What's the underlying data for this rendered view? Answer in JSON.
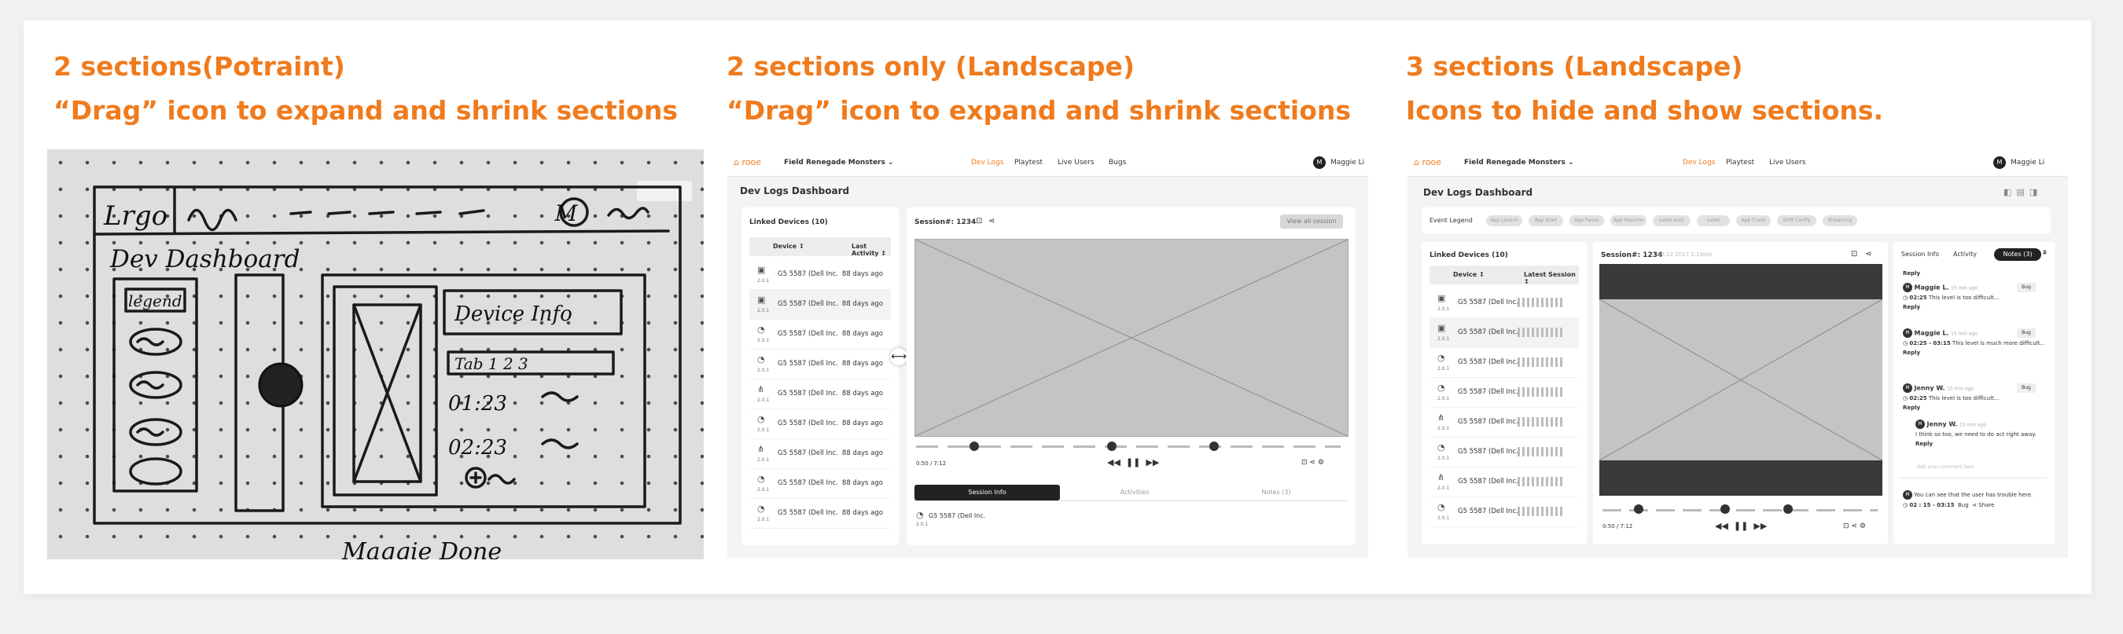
{
  "captions": [
    {
      "line1": "2 sections(Potraint)",
      "line2": "“Drag” icon to expand and shrink sections"
    },
    {
      "line1": "2 sections only (Landscape)",
      "line2": "“Drag” icon to expand and shrink sections"
    },
    {
      "line1": "3 sections (Landscape)",
      "line2": "Icons to hide and show sections."
    }
  ],
  "sketch": {
    "logo": "Lrgo",
    "title": "Dev Dashboard",
    "legend": "legend",
    "device_info": "Device Info",
    "tabs": "Tab 1 2 3",
    "times": [
      "01:23",
      "02:23"
    ],
    "avatar": "M",
    "footer": "Maggie Done"
  },
  "landscape2": {
    "brand": "rooe",
    "project": "Field Renegade Monsters",
    "nav": [
      "Dev Logs",
      "Playtest",
      "Live Users",
      "Bugs"
    ],
    "user": "Maggie Li",
    "avatar": "M",
    "page_title": "Dev Logs Dashboard",
    "devices_title": "Linked Devices (10)",
    "col_device": "Device",
    "col_activity": "Last Activity",
    "device_name": "G5 5587 (Dell Inc.",
    "version": "2.0.1",
    "rows": [
      "88 days ago",
      "88 days ago",
      "88 days ago",
      "88 days ago",
      "88 days ago",
      "88 days ago",
      "88 days ago",
      "88 days ago",
      "88 days ago"
    ],
    "row_icons": [
      "▣",
      "▣",
      "◔",
      "◔",
      "⋔",
      "◔",
      "⋔",
      "◔",
      "◔"
    ],
    "session_label": "Session#: 1234",
    "view_all": "View all session",
    "time": "0:50 / 7:12",
    "tabs": [
      "Session Info",
      "Activities",
      "Notes (3)"
    ],
    "info_device": "G5 5587 (Dell Inc.",
    "drag_icon": "⟷"
  },
  "landscape3": {
    "brand": "rooe",
    "project": "Field Renegade Monsters",
    "nav": [
      "Dev Logs",
      "Playtest",
      "Live Users"
    ],
    "user": "Maggie Li",
    "avatar": "M",
    "page_title": "Dev Logs Dashboard",
    "legend_label": "Event Legend",
    "chips": [
      "App Launch",
      "App Start",
      "App Pause",
      "App Resume",
      "Level start",
      "Level",
      "App Crash",
      "Shift Config",
      "Streaming"
    ],
    "devices_title": "Linked Devices (10)",
    "col_device": "Device",
    "col_session": "Latest Session",
    "device_name": "G5 5587 (Dell Inc.",
    "version": "2.0.1",
    "row_icons": [
      "▣",
      "▣",
      "◔",
      "◔",
      "⋔",
      "◔",
      "⋔",
      "◔"
    ],
    "session_label": "Session#: 1234",
    "session_date": "08.12.2017 2:10pm",
    "time": "0:50 / 7:12",
    "side_tabs": [
      "Session Info",
      "Activity",
      "Notes (3)"
    ],
    "reply": "Reply",
    "bug": "Bug",
    "notes": [
      {
        "author": "Maggie L.",
        "ago": "15 min ago",
        "time": "02:25",
        "text": "This level is too difficult..."
      },
      {
        "author": "Maggie L.",
        "ago": "15 min ago",
        "time": "02:25 - 03:15",
        "text": "This level is much more difficult..."
      },
      {
        "author": "Jenny W.",
        "ago": "15 min ago",
        "time": "02:25",
        "text": "This level is too difficult..."
      }
    ],
    "reply_note": {
      "author": "Jenny W.",
      "ago": "15 min ago",
      "text": "I think so too, we need to do act right away."
    },
    "comment_placeholder": "Add your comment here",
    "bottom_note": {
      "text": "You can see that the user has trouble here.",
      "time": "02 : 15 - 03:15",
      "bug": "Bug",
      "share": "Share"
    }
  }
}
